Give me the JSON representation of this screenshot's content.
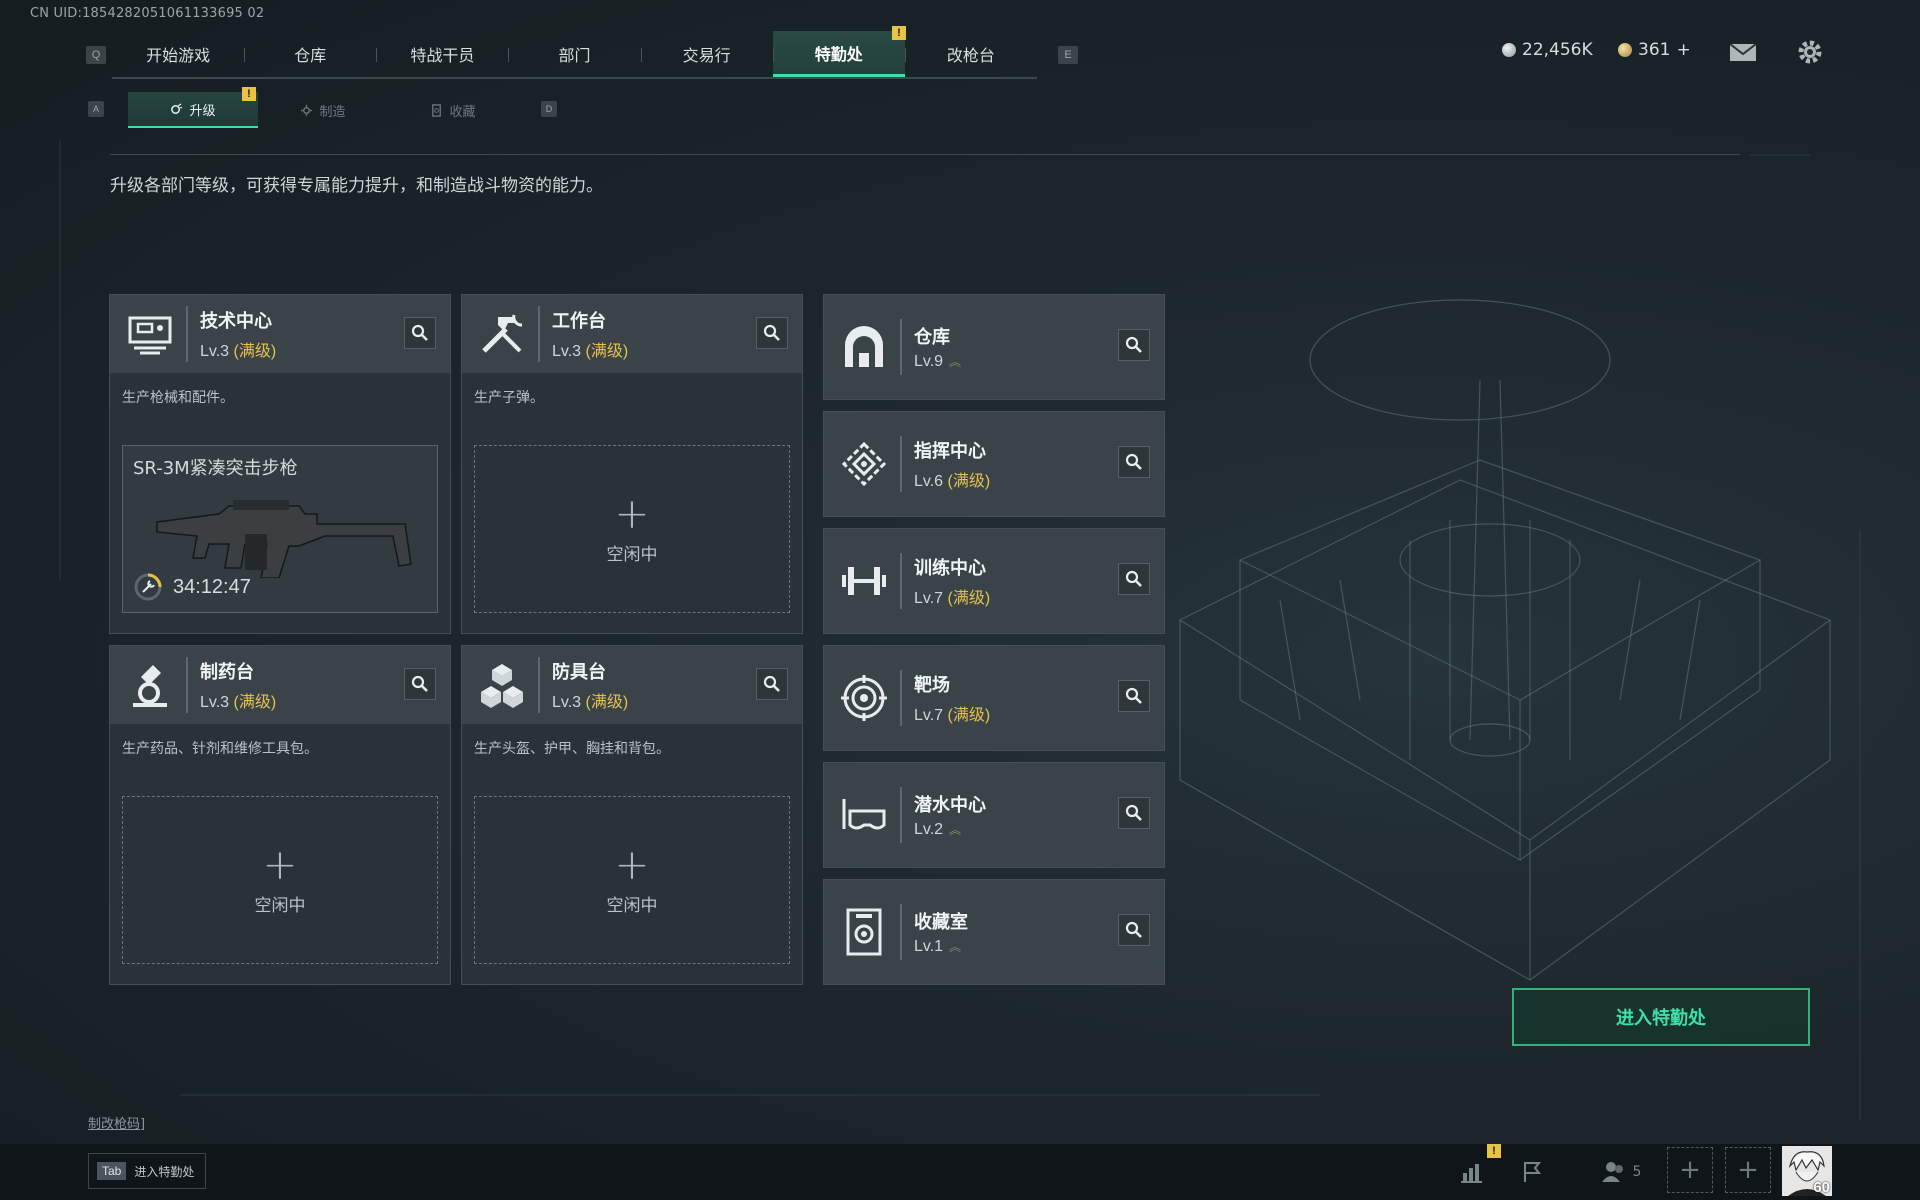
{
  "uid_text": "CN UID:1854282051061133695 02",
  "nav": {
    "prev_key": "Q",
    "next_key": "E",
    "tabs": [
      "开始游戏",
      "仓库",
      "特战干员",
      "部门",
      "交易行",
      "特勤处",
      "改枪台"
    ],
    "active": "特勤处",
    "alert_mark": "!"
  },
  "subnav": {
    "prev_key": "A",
    "next_key": "D",
    "tabs": [
      "升级",
      "制造",
      "收藏"
    ],
    "active": "升级",
    "alert_mark": "!"
  },
  "currency": {
    "silver": "22,456K",
    "gold": "361",
    "gold_add": "+"
  },
  "description": "升级各部门等级，可获得专属能力提升，和制造战斗物资的能力。",
  "workbenches": [
    {
      "title": "技术中心",
      "level": "Lv.3",
      "max_label": "(满级)",
      "desc": "生产枪械和配件。",
      "icon": "tech-center-icon"
    },
    {
      "title": "工作台",
      "level": "Lv.3",
      "max_label": "(满级)",
      "desc": "生产子弹。",
      "icon": "workbench-icon"
    },
    {
      "title": "制药台",
      "level": "Lv.3",
      "max_label": "(满级)",
      "desc": "生产药品、针剂和维修工具包。",
      "icon": "pharmacy-icon"
    },
    {
      "title": "防具台",
      "level": "Lv.3",
      "max_label": "(满级)",
      "desc": "生产头盔、护甲、胸挂和背包。",
      "icon": "armor-bench-icon"
    }
  ],
  "production": {
    "item_name": "SR-3M紧凑突击步枪",
    "timer": "34:12:47"
  },
  "idle_slot": {
    "plus": "+",
    "label": "空闲中"
  },
  "departments": [
    {
      "title": "仓库",
      "level": "Lv.9",
      "max_label": "",
      "upgradable": true,
      "icon": "warehouse-icon"
    },
    {
      "title": "指挥中心",
      "level": "Lv.6",
      "max_label": "(满级)",
      "upgradable": false,
      "icon": "command-center-icon"
    },
    {
      "title": "训练中心",
      "level": "Lv.7",
      "max_label": "(满级)",
      "upgradable": false,
      "icon": "training-center-icon"
    },
    {
      "title": "靶场",
      "level": "Lv.7",
      "max_label": "(满级)",
      "upgradable": false,
      "icon": "shooting-range-icon"
    },
    {
      "title": "潜水中心",
      "level": "Lv.2",
      "max_label": "",
      "upgradable": true,
      "icon": "diving-center-icon"
    },
    {
      "title": "收藏室",
      "level": "Lv.1",
      "max_label": "",
      "upgradable": true,
      "icon": "collection-room-icon"
    }
  ],
  "enter_button": "进入特勤处",
  "bottom": {
    "gun_code_link": "制改枪码]",
    "tab_key": "Tab",
    "tab_label": "进入特勤处",
    "squad_count": "5",
    "player_level": "60",
    "alert_mark": "!"
  },
  "colors": {
    "accent": "#3fe0a8",
    "max_level": "#e6c04d",
    "warn": "#e9c345"
  }
}
